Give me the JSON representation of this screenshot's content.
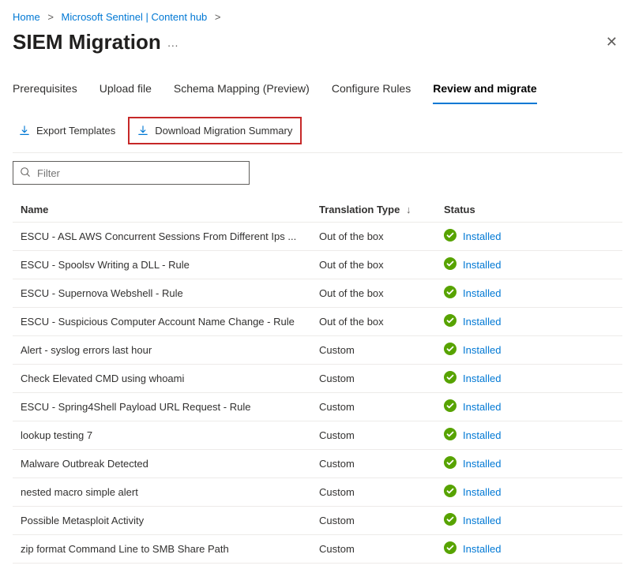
{
  "breadcrumb": {
    "home": "Home",
    "sentinel": "Microsoft Sentinel | Content hub"
  },
  "page": {
    "title": "SIEM Migration",
    "more": "···"
  },
  "tabs": [
    {
      "label": "Prerequisites",
      "active": false
    },
    {
      "label": "Upload file",
      "active": false
    },
    {
      "label": "Schema Mapping (Preview)",
      "active": false
    },
    {
      "label": "Configure Rules",
      "active": false
    },
    {
      "label": "Review and migrate",
      "active": true
    }
  ],
  "toolbar": {
    "export": "Export Templates",
    "download": "Download Migration Summary"
  },
  "filter": {
    "placeholder": "Filter"
  },
  "columns": {
    "name": "Name",
    "type": "Translation Type",
    "sort_indicator": "↓",
    "status": "Status"
  },
  "status_label": "Installed",
  "rows": [
    {
      "name": "ESCU - ASL AWS Concurrent Sessions From Different Ips ...",
      "type": "Out of the box",
      "status": "Installed"
    },
    {
      "name": "ESCU - Spoolsv Writing a DLL - Rule",
      "type": "Out of the box",
      "status": "Installed"
    },
    {
      "name": "ESCU - Supernova Webshell - Rule",
      "type": "Out of the box",
      "status": "Installed"
    },
    {
      "name": "ESCU - Suspicious Computer Account Name Change - Rule",
      "type": "Out of the box",
      "status": "Installed"
    },
    {
      "name": "Alert - syslog errors last hour",
      "type": "Custom",
      "status": "Installed"
    },
    {
      "name": "Check Elevated CMD using whoami",
      "type": "Custom",
      "status": "Installed"
    },
    {
      "name": "ESCU - Spring4Shell Payload URL Request - Rule",
      "type": "Custom",
      "status": "Installed"
    },
    {
      "name": "lookup testing 7",
      "type": "Custom",
      "status": "Installed"
    },
    {
      "name": "Malware Outbreak Detected",
      "type": "Custom",
      "status": "Installed"
    },
    {
      "name": "nested macro simple alert",
      "type": "Custom",
      "status": "Installed"
    },
    {
      "name": "Possible Metasploit Activity",
      "type": "Custom",
      "status": "Installed"
    },
    {
      "name": "zip format Command Line to SMB Share Path",
      "type": "Custom",
      "status": "Installed"
    }
  ]
}
